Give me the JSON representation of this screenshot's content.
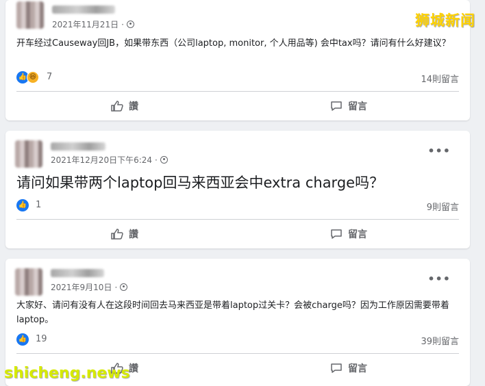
{
  "watermarks": {
    "top": "狮城新闻",
    "bottom": "shicheng.news"
  },
  "actions": {
    "like_label": "讚",
    "comment_label": "留言"
  },
  "posts": [
    {
      "date": "2021年11月21日",
      "text": "开车经过Causeway回JB，如果带东西（公司laptop, monitor, 个人用品等) 会中tax吗？请问有什么好建议？",
      "reaction_count": "7",
      "comment_count": "14則留言"
    },
    {
      "date": "2021年12月20日下午6:24",
      "text": "请问如果带两个laptop回马来西亚会中extra charge吗？",
      "reaction_count": "1",
      "comment_count": "9則留言"
    },
    {
      "date": "2021年9月10日",
      "text": "大家好、请问有没有人在这段时间回去马来西亚是带着laptop过关卡？会被charge吗？因为工作原因需要带着laptop。",
      "reaction_count": "19",
      "comment_count": "39則留言"
    }
  ],
  "colors": {
    "like": "#1877f2",
    "haha": "#f7b125",
    "watermark_top": "#ffd200",
    "watermark_bottom": "#d6ea00"
  }
}
